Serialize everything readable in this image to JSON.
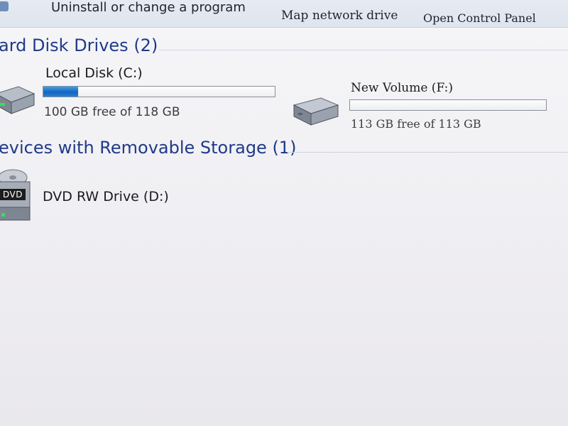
{
  "toolbar": {
    "uninstall_label": "Uninstall or change a program",
    "map_drive_label": "Map network drive",
    "control_panel_label": "Open Control Panel"
  },
  "groups": {
    "hard_disks": {
      "title": "ard Disk Drives (2)"
    },
    "removable": {
      "title": "evices with Removable Storage (1)"
    }
  },
  "drives": {
    "c": {
      "name": "Local Disk (C:)",
      "free_text": "100 GB free of 118 GB",
      "used_fraction": 0.15,
      "icon": "hard-drive-icon"
    },
    "f": {
      "name": "New Volume (F:)",
      "free_text": "113 GB free of 113 GB",
      "used_fraction": 0.0,
      "icon": "hard-drive-icon"
    },
    "d": {
      "name": "DVD RW Drive (D:)",
      "badge": "DVD",
      "icon": "dvd-drive-icon"
    }
  },
  "colors": {
    "header_blue": "#1f3a8a",
    "bar_fill": "#1565c0",
    "background": "#f2f1f4"
  }
}
